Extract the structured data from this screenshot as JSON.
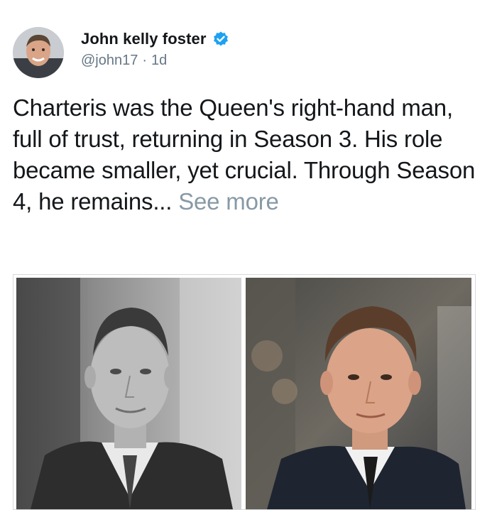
{
  "author": {
    "display_name": "John kelly foster",
    "handle": "@john17",
    "separator": "·",
    "timestamp": "1d",
    "verified": true
  },
  "tweet": {
    "text": "Charteris was the Queen's right-hand man, full of trust, returning in Season 3. His role became smaller, yet crucial. Through Season 4, he remains...",
    "see_more": "See more"
  },
  "media": {
    "left": "black-and-white portrait",
    "right": "color portrait"
  },
  "colors": {
    "verified_badge": "#1da1f2",
    "meta_text": "#657786",
    "see_more": "#8899a6"
  }
}
